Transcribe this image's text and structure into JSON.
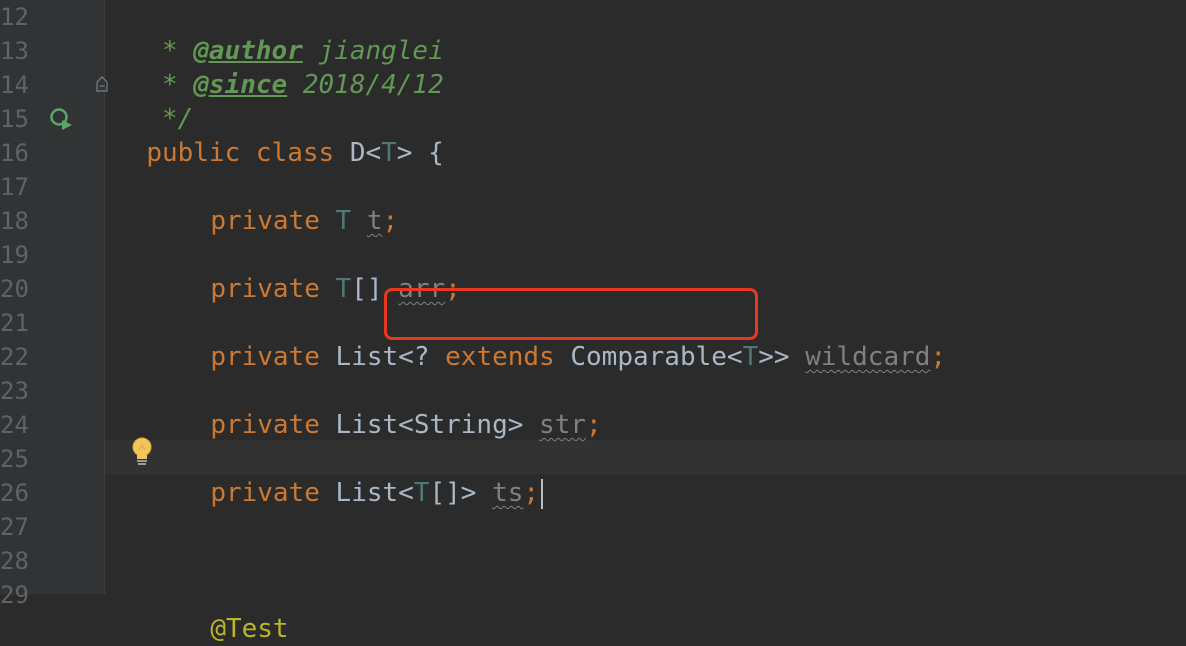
{
  "editor": {
    "line_numbers": [
      "12",
      "13",
      "14",
      "15",
      "16",
      "17",
      "18",
      "19",
      "20",
      "21",
      "22",
      "23",
      "24",
      "25",
      "26",
      "27",
      "28",
      "29"
    ],
    "lines": {
      "l12": {
        "star": " * ",
        "tag": "@author",
        "text": " jianglei"
      },
      "l13": {
        "star": " * ",
        "tag": "@since",
        "text": " 2018/4/12"
      },
      "l14": {
        "text": " */"
      },
      "l15": {
        "kw1": "public",
        "kw2": "class",
        "name": "D<",
        "type": "T",
        "rest": "> {"
      },
      "l17": {
        "kw": "private",
        "type": "T",
        "field": "t",
        "semi": ";"
      },
      "l19": {
        "kw": "private",
        "type": "T",
        "arr": "[]",
        "field": "arr",
        "semi": ";"
      },
      "l21": {
        "kw": "private",
        "list": "List<",
        "q": "?",
        "ext": "extends",
        "comp": "Comparable<",
        "type": "T",
        "close": ">>",
        "field": "wildcard",
        "semi": ";"
      },
      "l23": {
        "kw": "private",
        "list": "List<String>",
        "field": "str",
        "semi": ";"
      },
      "l25": {
        "kw": "private",
        "list": "List<",
        "type": "T",
        "close": "[]>",
        "field": "ts",
        "semi": ";"
      },
      "l29": {
        "ann": "@Test"
      }
    },
    "colors": {
      "background": "#2b2b2b",
      "keyword": "#cc7832",
      "comment": "#629755",
      "type_param": "#507874",
      "highlight_box": "#e8391f"
    },
    "icons": {
      "run": "run-gutter-icon",
      "fold": "fold-icon",
      "intention": "lightbulb-icon"
    }
  }
}
